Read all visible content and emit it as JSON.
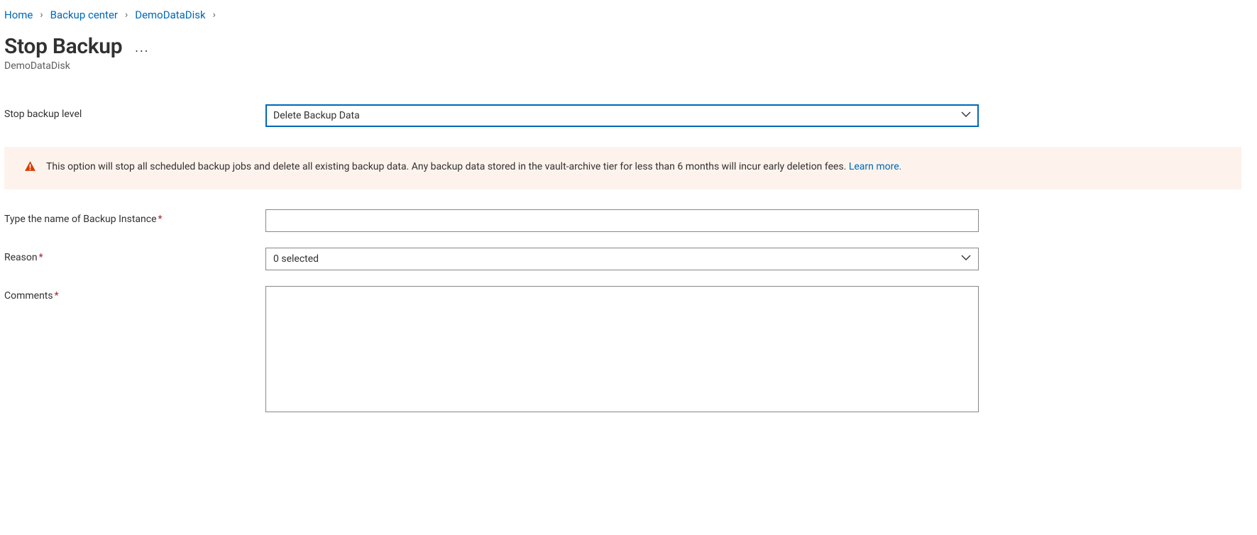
{
  "breadcrumb": {
    "items": [
      "Home",
      "Backup center",
      "DemoDataDisk"
    ]
  },
  "header": {
    "title": "Stop Backup",
    "subtitle": "DemoDataDisk",
    "more": "..."
  },
  "fields": {
    "stop_level_label": "Stop backup level",
    "stop_level_value": "Delete Backup Data",
    "instance_label": "Type the name of Backup Instance",
    "instance_value": "",
    "reason_label": "Reason",
    "reason_value": "0 selected",
    "comments_label": "Comments",
    "comments_value": ""
  },
  "banner": {
    "text": "This option will stop all scheduled backup jobs and delete all existing backup data. Any backup data stored in the vault-archive tier for less than 6 months will incur early deletion fees.",
    "link_text": "Learn more."
  }
}
